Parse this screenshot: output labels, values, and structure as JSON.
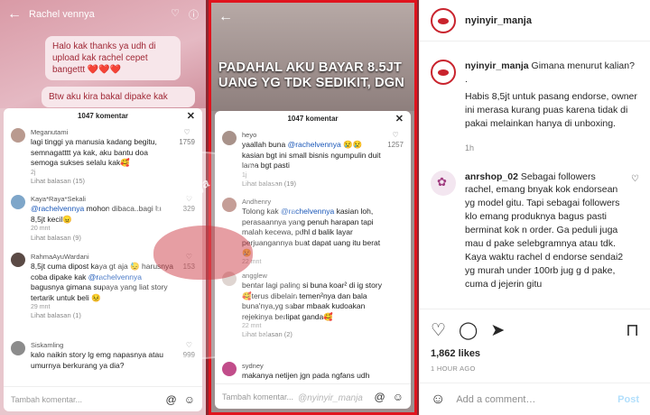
{
  "header": {
    "username": "nyinyir_manja"
  },
  "caption": {
    "username": "nyinyir_manja",
    "text_line1": "Gimana menurut kalian?",
    "dot": ".",
    "text_line2": "Habis 8,5jt untuk pasang endorse, owner ini merasa kurang puas karena tidak di pakai melainkan hanya di unboxing.",
    "time": "1h"
  },
  "comment": {
    "username": "anrshop_02",
    "text": "Sebagai followers rachel, emang bnyak kok endorsean yg model gitu. Tapi sebagai followers klo emang produknya bagus pasti berminat kok n order. Ga peduli juga mau d pake selebgramnya atau tdk. Kaya waktu rachel d endorse sendai2 yg murah under 100rb jug g d pake, cuma d jejerin gitu"
  },
  "likes": "1,862 likes",
  "post_time": "1 HOUR AGO",
  "add_comment": {
    "placeholder": "Add a comment…",
    "post_label": "Post"
  },
  "post_image": {
    "left_header": "Rachel vennya",
    "left_bubble1": "Halo kak thanks ya udh di upload kak rachel cepet bangettt ❤️❤️❤️",
    "left_bubble2": "Btw aku kira bakal dipake kak",
    "comment_count": "1047 komentar",
    "banner": "PADAHAL AKU BAYAR 8.5JT UANG YG TDK SEDIKIT, DGN",
    "left_comments": [
      {
        "user": "Meganutami",
        "text": "lagi tinggi ya manusia kadang begitu, semnagatttt ya kak, aku bantu doa semoga sukses selalu kak🥰",
        "meta": "2j",
        "likes": "1759",
        "replies": "Lihat balasan (15)"
      },
      {
        "user": "Kaya*Raya*Sekali",
        "mention": "@rachelvennya",
        "text": " mohon dibaca..bagi lu 8,5jt kecil😠",
        "meta": "20 mnt",
        "likes": "329",
        "replies": "Lihat balasan (9)"
      },
      {
        "user": "RahmaAyuWardani",
        "text": "8,5jt cuma dipost kaya gt aja 😓 harusnya coba dipake kak ",
        "mention": "@rachelvennya",
        "text2": " bagusnya gimana supaya yang liat story tertarik untuk beli 😣",
        "meta": "29 mnt",
        "likes": "153",
        "replies": "Lihat balasan (1)"
      },
      {
        "user": "Siskamling",
        "text": "kalo naikin story lg emg napasnya atau umurnya berkurang ya dia?",
        "likes": "999"
      }
    ],
    "right_comments": [
      {
        "user": "heyo",
        "text": "yaallah buna ",
        "mention": "@rachelvennya",
        "text2": " 😢😢 kasian bgt ini small bisnis ngumpulin duit lama bgt pasti",
        "meta": "1j",
        "likes": "1257",
        "replies": "Lihat balasan (19)"
      },
      {
        "user": "Andhenry",
        "text": "Tolong kak ",
        "mention": "@rachelvennya",
        "text2": " kasian loh, perasaannya yang penuh harapan tapi malah kecewa, pdhl d balik layar perjuangannya buat dapat uang itu berat 😢",
        "meta": "22 mnt"
      },
      {
        "user": "angglew",
        "text": "bentar lagi paling si buna koar² di ig story🥰terus dibelain temen²nya dan bala buna'nya,yg sabar mbaak kudoakan rejekinya berlipat ganda🥰",
        "meta": "22 mnt",
        "replies": "Lihat balasan (2)"
      },
      {
        "user": "sydney",
        "text": "makanya netijen jgn pada ngfans udh"
      }
    ],
    "footer_placeholder": "Tambah komentar...",
    "watermark": "@nyinyir_manja"
  }
}
